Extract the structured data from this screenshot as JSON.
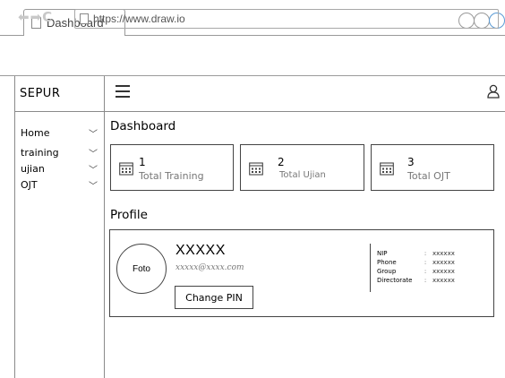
{
  "browser": {
    "tab_title": "Dashboard",
    "url": "https://www.draw.io"
  },
  "app": {
    "brand": "SEPUR",
    "menu": [
      {
        "label": "Home"
      },
      {
        "label": "training"
      },
      {
        "label": "ujian"
      },
      {
        "label": "OJT"
      }
    ]
  },
  "dashboard": {
    "title": "Dashboard",
    "cards": [
      {
        "number": "1",
        "label": "Total Training"
      },
      {
        "number": "2",
        "label": "Total Ujian"
      },
      {
        "number": "3",
        "label": "Total OJT"
      }
    ]
  },
  "profile": {
    "title": "Profile",
    "photo_label": "Foto",
    "name": "XXXXX",
    "email": "xxxxx@xxxx.com",
    "change_pin_label": "Change PIN",
    "details": [
      {
        "key": "NIP",
        "sep": ":",
        "value": "xxxxxx"
      },
      {
        "key": "Phone",
        "sep": ":",
        "value": "xxxxxx"
      },
      {
        "key": "Group",
        "sep": ":",
        "value": "xxxxxx"
      },
      {
        "key": "Directorate",
        "sep": ":",
        "value": "xxxxxx"
      }
    ]
  },
  "icons": {
    "nav_arrows": "back-forward-reload-icons",
    "menu": "hamburger-icon",
    "user": "user-icon",
    "calendar": "calendar-icon"
  },
  "colors": {
    "border": "#444444",
    "chrome_border": "#9a9a9a",
    "muted_text": "#777777",
    "window_control_accent": "#5b9bd5"
  }
}
